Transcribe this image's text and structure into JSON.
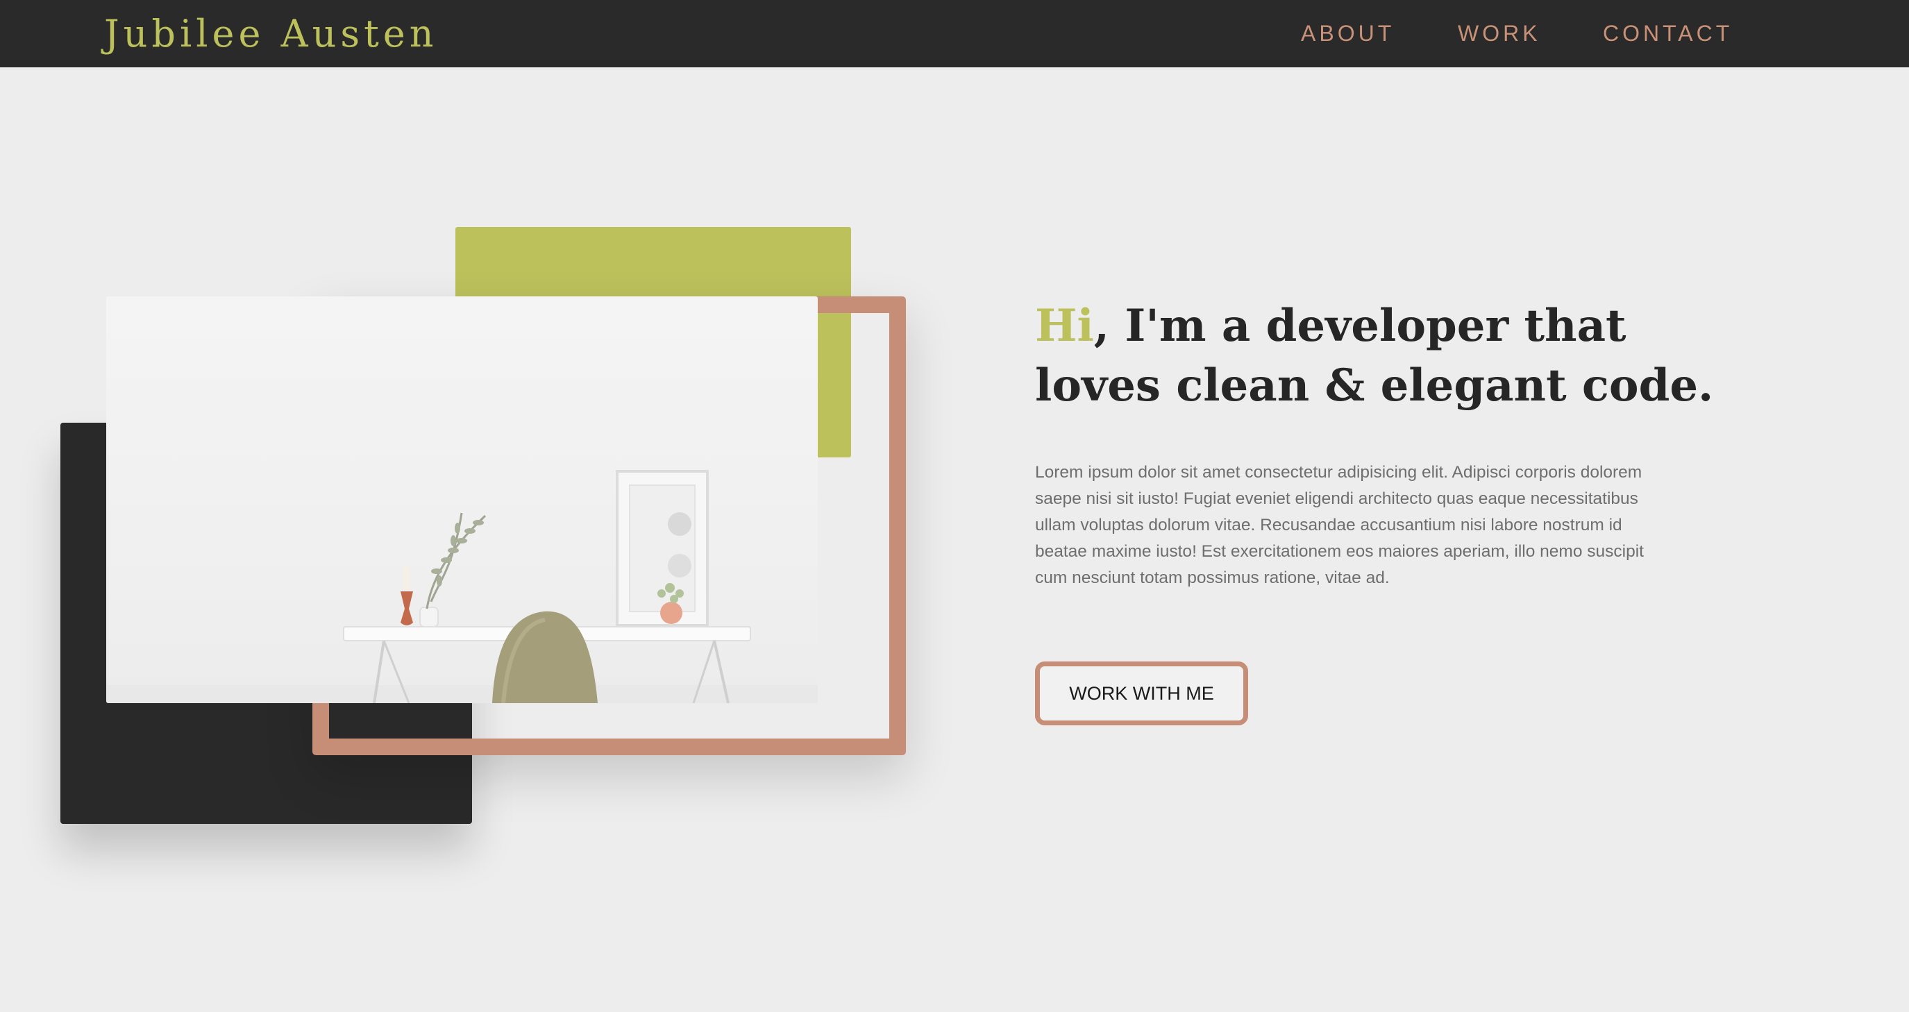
{
  "brand": "Jubilee Austen",
  "nav": {
    "about": "ABOUT",
    "work": "WORK",
    "contact": "CONTACT"
  },
  "hero": {
    "greeting": "Hi",
    "headline_rest": ", I'm a developer that loves clean & elegant code.",
    "body": "Lorem ipsum dolor sit amet consectetur adipisicing elit. Adipisci corporis dolorem saepe nisi sit iusto! Fugiat eveniet eligendi architecto quas eaque necessitatibus ullam voluptas dolorum vitae. Recusandae accusantium nisi labore nostrum id beatae maxime iusto! Est exercitationem eos maiores aperiam, illo nemo suscipit cum nesciunt totam possimus ratione, vitae ad.",
    "cta_label": "WORK WITH ME"
  },
  "colors": {
    "dark": "#2a2a2a",
    "accent_green": "#bcc15c",
    "accent_copper": "#c68e76",
    "background": "#ededed"
  }
}
